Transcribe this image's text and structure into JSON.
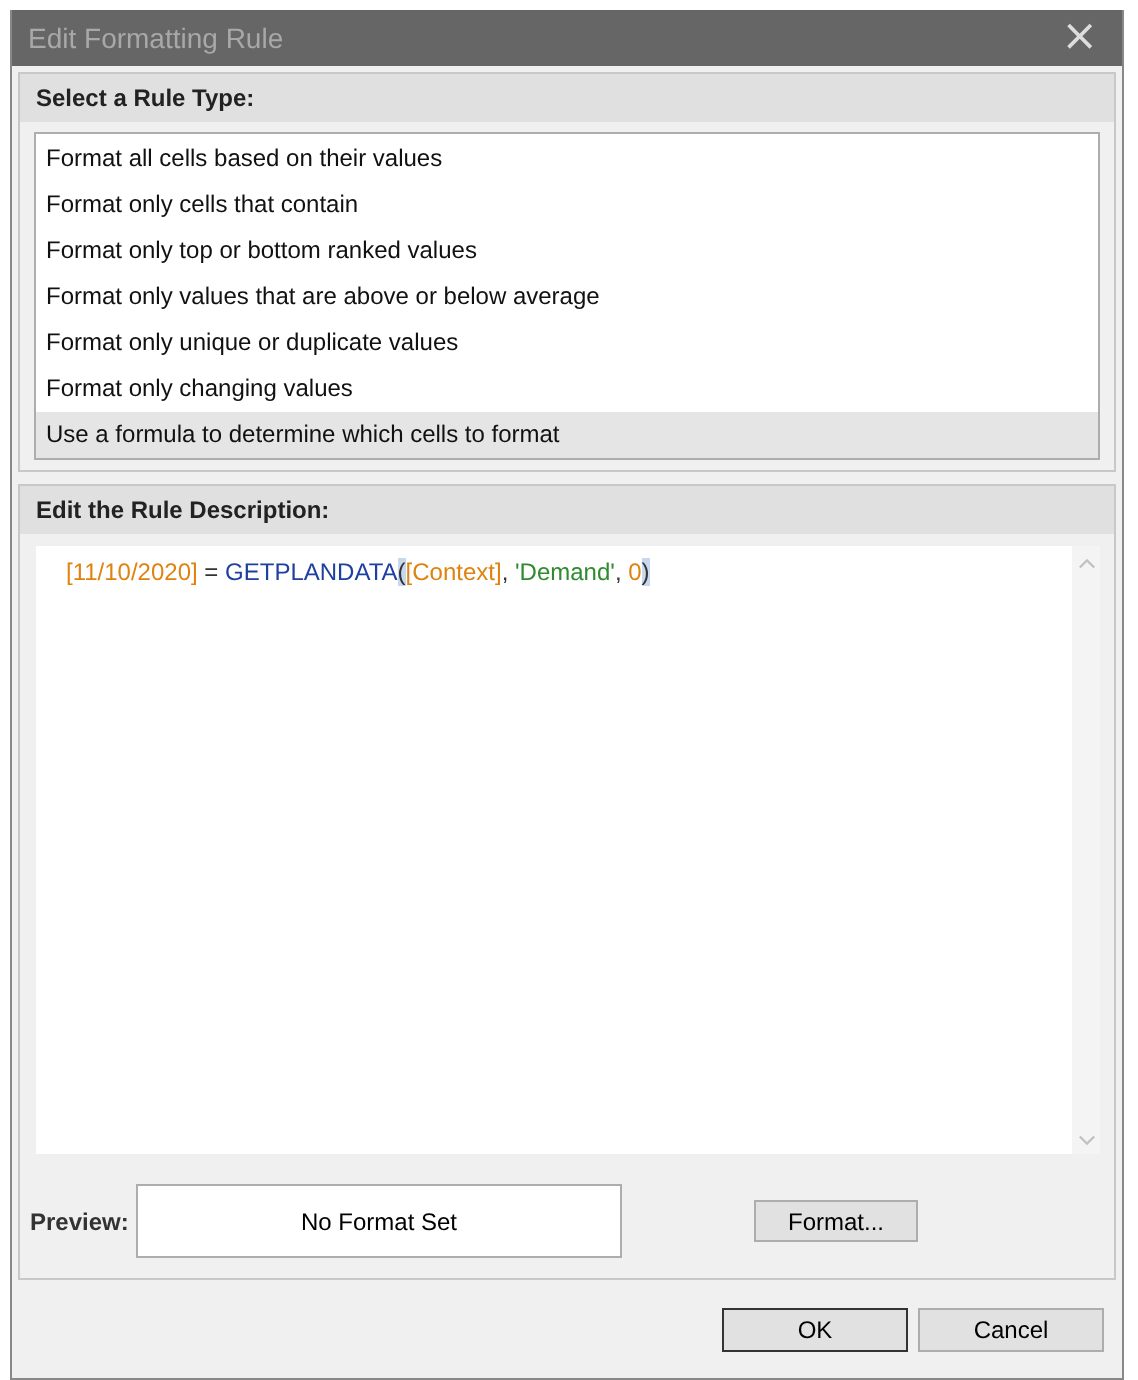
{
  "window": {
    "title": "Edit Formatting Rule",
    "close": "×"
  },
  "rule_type": {
    "heading": "Select a Rule Type:",
    "items": [
      {
        "label": "Format all cells based on their values",
        "selected": false
      },
      {
        "label": "Format only cells that contain",
        "selected": false
      },
      {
        "label": "Format only top or bottom ranked values",
        "selected": false
      },
      {
        "label": "Format only values that are above or below average",
        "selected": false
      },
      {
        "label": "Format only unique or duplicate values",
        "selected": false
      },
      {
        "label": "Format only changing values",
        "selected": false
      },
      {
        "label": "Use a formula to determine which cells to format",
        "selected": true
      }
    ]
  },
  "description": {
    "heading": "Edit the Rule Description:",
    "formula": [
      {
        "text": "[11/10/2020]",
        "kind": "reference"
      },
      {
        "text": " = ",
        "kind": "operator"
      },
      {
        "text": "GETPLANDATA",
        "kind": "function"
      },
      {
        "text": "(",
        "kind": "brace"
      },
      {
        "text": "[Context]",
        "kind": "reference"
      },
      {
        "text": ", ",
        "kind": "operator"
      },
      {
        "text": "'Demand'",
        "kind": "string"
      },
      {
        "text": ", ",
        "kind": "operator"
      },
      {
        "text": "0",
        "kind": "number"
      },
      {
        "text": ")",
        "kind": "brace"
      }
    ],
    "preview_label": "Preview:",
    "preview": "No Format Set",
    "format_button": "Format..."
  },
  "buttons": [
    {
      "label": "OK",
      "kind": "default"
    },
    {
      "label": "Cancel",
      "kind": "normal"
    }
  ]
}
